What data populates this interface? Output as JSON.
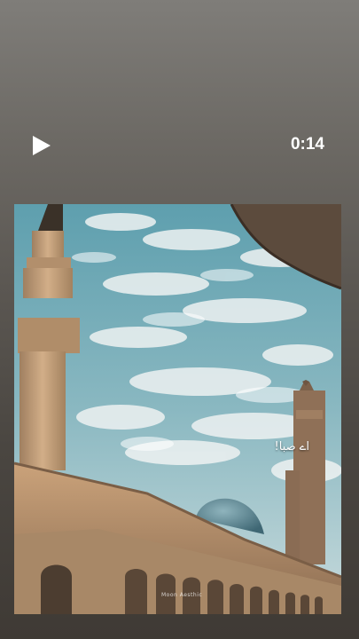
{
  "player": {
    "play_icon": "play-icon",
    "timestamp": "0:14"
  },
  "video": {
    "caption": "اے صبا!",
    "watermark": "Moon Aesthic"
  },
  "colors": {
    "sky": "#6fa6b4",
    "clouds": "#e8eeef",
    "building": "#c9a27a",
    "dome": "#5f8794"
  }
}
